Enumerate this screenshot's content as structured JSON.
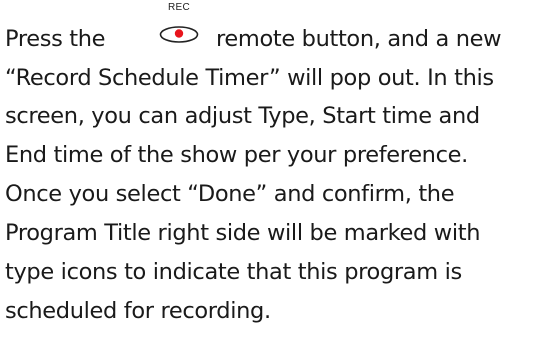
{
  "remote_button": {
    "label": "REC",
    "icon": "rec-button-icon",
    "dot_color": "#e8141c"
  },
  "paragraph": {
    "line1_before": "Press the",
    "line1_after": "remote button, and a new",
    "line2": "“Record Schedule Timer” will pop out.  In this",
    "line3": "screen, you can adjust Type, Start time and",
    "line4": "End time of the show per your preference.",
    "line5": "Once you select “Done” and confirm, the",
    "line6": "Program Title right side will be marked with",
    "line7": "type icons to indicate that this program is",
    "line8": "scheduled for recording."
  }
}
